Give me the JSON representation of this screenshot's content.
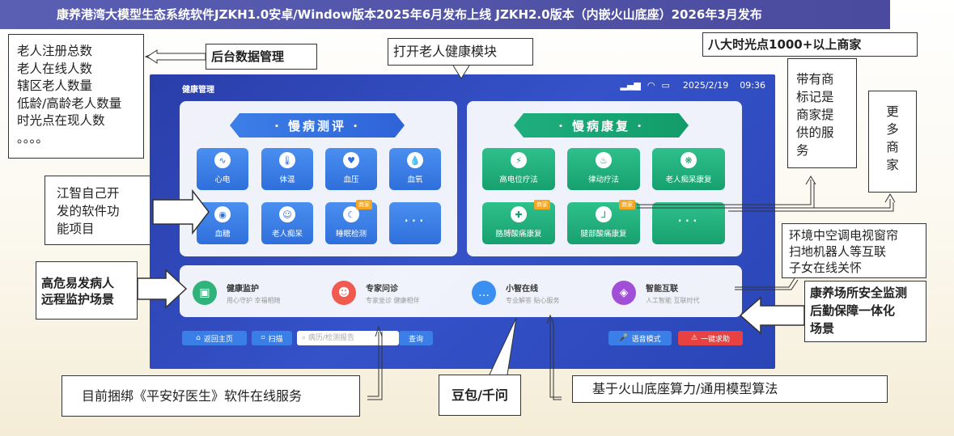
{
  "banner": "康养港湾大模型生态系统软件JZKH1.0安卓/Window版本2025年6月发布上线  JZKH2.0版本（内嵌火山底座）2026年3月发布",
  "notes": {
    "stats": [
      "老人注册总数",
      "老人在线人数",
      "辖区老人数量",
      "低龄/高龄老人数量",
      "时光点在现人数",
      "。。。。"
    ],
    "backend": "后台数据管理",
    "open_module": "打开老人健康模块",
    "merchants": "八大时光点1000+以上商家",
    "merchant_mark_l1": "带有商",
    "merchant_mark_l2": "标记是",
    "merchant_mark_l3": "商家提",
    "merchant_mark_l4": "供的服",
    "merchant_mark_l5": "务",
    "more_merchants": [
      "更",
      "多",
      "商",
      "家"
    ],
    "self_dev": [
      "江智自己开",
      "发的软件功",
      "能项目"
    ],
    "iot": [
      "环境中空调电视窗帘",
      "扫地机器人等互联",
      "子女在线关怀"
    ],
    "high_risk": [
      "高危易发病人",
      "远程监护场景"
    ],
    "safety": [
      "康养场所安全监测",
      "后勤保障一体化",
      "场景"
    ],
    "pingan": "目前捆绑《平安好医生》软件在线服务",
    "doubao": "豆包/千问",
    "volcano": "基于火山底座算力/通用模型算法"
  },
  "tablet": {
    "title": "健康管理",
    "date": "2025/2/19",
    "time": "09:36",
    "left_ribbon": "· 慢病测评 ·",
    "right_ribbon": "· 慢病康复 ·",
    "merchant_badge": "商家",
    "left_tiles": [
      {
        "label": "心电",
        "icon": "ecg-icon",
        "glyph": "∿"
      },
      {
        "label": "体温",
        "icon": "thermometer-icon",
        "glyph": "🌡"
      },
      {
        "label": "血压",
        "icon": "blood-pressure-icon",
        "glyph": "♥"
      },
      {
        "label": "血氧",
        "icon": "blood-drop-icon",
        "glyph": "💧"
      },
      {
        "label": "血糖",
        "icon": "glucose-icon",
        "glyph": "◉"
      },
      {
        "label": "老人痴呆",
        "icon": "brain-icon",
        "glyph": "☺"
      },
      {
        "label": "睡眠检测",
        "icon": "moon-icon",
        "glyph": "☾"
      },
      {
        "label": "···",
        "icon": "more-icon",
        "glyph": ""
      }
    ],
    "right_tiles": [
      {
        "label": "高电位疗法",
        "icon": "electric-therapy-icon",
        "glyph": "⚡"
      },
      {
        "label": "律动疗法",
        "icon": "rhythm-therapy-icon",
        "glyph": "♨"
      },
      {
        "label": "老人痴呆康复",
        "icon": "rehab-brain-icon",
        "glyph": "❋"
      },
      {
        "label": "胳膊酸痛康复",
        "icon": "arm-icon",
        "glyph": "✚"
      },
      {
        "label": "腿部酸痛康复",
        "icon": "leg-icon",
        "glyph": "⅃"
      },
      {
        "label": "···",
        "icon": "more-icon",
        "glyph": ""
      }
    ],
    "services": [
      {
        "title": "健康监护",
        "sub": "用心守护 幸福相随",
        "color": "#2fb37a",
        "glyph": "▣"
      },
      {
        "title": "专家问诊",
        "sub": "专家坐诊 健康相伴",
        "color": "#f05a4f",
        "glyph": "☻"
      },
      {
        "title": "小智在线",
        "sub": "专业解答 贴心服务",
        "color": "#3a8ff0",
        "glyph": "…"
      },
      {
        "title": "智能互联",
        "sub": "人工智能 互联时代",
        "color": "#a24fd8",
        "glyph": "◈"
      }
    ],
    "back_home": "返回主页",
    "scan": "扫描",
    "search_placeholder": "病历/检测报告",
    "query": "查询",
    "voice": "语音模式",
    "sos": "一键求助"
  },
  "colors": {
    "banner": "#4f52a8",
    "tablet": "#3146b8",
    "blue_tile": "#3a7fe8",
    "green_tile": "#1fae7e",
    "badge": "#f5a623",
    "sos": "#e84141"
  }
}
